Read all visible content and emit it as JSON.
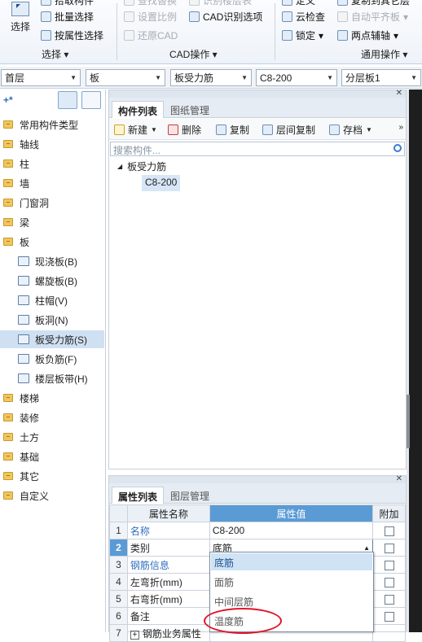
{
  "ribbon": {
    "select_big": "选择",
    "partial_top": "拾取构件",
    "batch_select": "批量选择",
    "attr_select": "按属性选择",
    "group_select": "选择",
    "cad_top1": "查找替换",
    "cad_top2": "识别楼层表",
    "set_scale": "设置比例",
    "cad_identify": "CAD识别选项",
    "restore_cad": "还原CAD",
    "group_cad": "CAD操作",
    "gen_top1": "定义",
    "gen_top2": "复制到其它层",
    "cloud_check": "云检查",
    "auto_align": "自动平齐板",
    "lock": "锁定",
    "two_point_axis": "两点辅轴",
    "group_general": "通用操作"
  },
  "dropdowns": [
    "首层",
    "板",
    "板受力筋",
    "C8-200",
    "分层板1"
  ],
  "tree": {
    "items": [
      {
        "label": "常用构件类型",
        "type": "folder"
      },
      {
        "label": "轴线",
        "type": "folder"
      },
      {
        "label": "柱",
        "type": "folder"
      },
      {
        "label": "墙",
        "type": "folder"
      },
      {
        "label": "门窗洞",
        "type": "folder"
      },
      {
        "label": "梁",
        "type": "folder"
      },
      {
        "label": "板",
        "type": "folder-open"
      },
      {
        "label": "现浇板(B)",
        "type": "child"
      },
      {
        "label": "螺旋板(B)",
        "type": "child"
      },
      {
        "label": "柱帽(V)",
        "type": "child"
      },
      {
        "label": "板洞(N)",
        "type": "child"
      },
      {
        "label": "板受力筋(S)",
        "type": "child",
        "selected": true
      },
      {
        "label": "板负筋(F)",
        "type": "child"
      },
      {
        "label": "楼层板带(H)",
        "type": "child"
      },
      {
        "label": "楼梯",
        "type": "folder"
      },
      {
        "label": "装修",
        "type": "folder"
      },
      {
        "label": "土方",
        "type": "folder"
      },
      {
        "label": "基础",
        "type": "folder"
      },
      {
        "label": "其它",
        "type": "folder"
      },
      {
        "label": "自定义",
        "type": "folder"
      }
    ]
  },
  "component_panel": {
    "tab_active": "构件列表",
    "tab_inactive": "图纸管理",
    "new": "新建",
    "delete": "删除",
    "copy": "复制",
    "floor_copy": "层间复制",
    "save": "存档",
    "search_placeholder": "搜索构件...",
    "tree_root": "板受力筋",
    "tree_child": "C8-200"
  },
  "property_panel": {
    "tab_active": "属性列表",
    "tab_inactive": "图层管理",
    "col_name": "属性名称",
    "col_value": "属性值",
    "col_extra": "附加",
    "rows": [
      {
        "n": "1",
        "name": "名称",
        "value": "C8-200"
      },
      {
        "n": "2",
        "name": "类别",
        "value": "底筋"
      },
      {
        "n": "3",
        "name": "钢筋信息",
        "value": ""
      },
      {
        "n": "4",
        "name": "左弯折(mm)",
        "value": ""
      },
      {
        "n": "5",
        "name": "右弯折(mm)",
        "value": ""
      },
      {
        "n": "6",
        "name": "备注",
        "value": ""
      },
      {
        "n": "7",
        "name": "钢筋业务属性",
        "value": ""
      }
    ]
  },
  "category_options": [
    "底筋",
    "面筋",
    "中间层筋",
    "温度筋"
  ],
  "colors": {
    "accent": "#5b9bd5",
    "highlight_circle": "#e0142a"
  }
}
